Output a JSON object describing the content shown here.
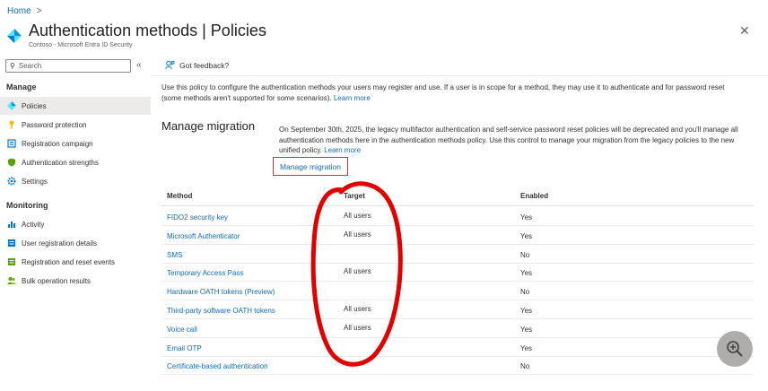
{
  "breadcrumb": {
    "home": "Home",
    "separator": ">"
  },
  "header": {
    "title": "Authentication methods | Policies",
    "subtitle": "Contoso - Microsoft Entra ID Security",
    "more": "···",
    "close": "✕"
  },
  "sidebar": {
    "search_placeholder": "Search",
    "collapse": "«",
    "sections": [
      {
        "label": "Manage"
      },
      {
        "label": "Monitoring"
      }
    ],
    "items": [
      {
        "label": "Policies",
        "icon": "diamond-icon"
      },
      {
        "label": "Password protection",
        "icon": "key-icon"
      },
      {
        "label": "Registration campaign",
        "icon": "campaign-icon"
      },
      {
        "label": "Authentication strengths",
        "icon": "shield-icon"
      },
      {
        "label": "Settings",
        "icon": "gear-icon"
      },
      {
        "label": "Activity",
        "icon": "activity-icon"
      },
      {
        "label": "User registration details",
        "icon": "user-details-icon"
      },
      {
        "label": "Registration and reset events",
        "icon": "events-icon"
      },
      {
        "label": "Bulk operation results",
        "icon": "bulk-users-icon"
      }
    ]
  },
  "toolbar": {
    "feedback": "Got feedback?"
  },
  "description": {
    "text": "Use this policy to configure the authentication methods your users may register and use. If a user is in scope for a method, they may use it to authenticate and for password reset (some methods aren't supported for some scenarios).",
    "link": "Learn more"
  },
  "migration": {
    "title": "Manage migration",
    "text": "On September 30th, 2025, the legacy multifactor authentication and self-service password reset policies will be deprecated and you'll manage all authentication methods here in the authentication methods policy. Use this control to manage your migration from the legacy policies to the new unified policy.",
    "link": "Learn more",
    "button": "Manage migration"
  },
  "table": {
    "columns": [
      "Method",
      "Target",
      "Enabled"
    ],
    "rows": [
      {
        "method": "FIDO2 security key",
        "target": "All users",
        "enabled": "Yes"
      },
      {
        "method": "Microsoft Authenticator",
        "target": "All users",
        "enabled": "Yes"
      },
      {
        "method": "SMS",
        "target": "",
        "enabled": "No"
      },
      {
        "method": "Temporary Access Pass",
        "target": "All users",
        "enabled": "Yes"
      },
      {
        "method": "Hardware OATH tokens (Preview)",
        "target": "",
        "enabled": "No"
      },
      {
        "method": "Third-party software OATH tokens",
        "target": "All users",
        "enabled": "Yes"
      },
      {
        "method": "Voice call",
        "target": "All users",
        "enabled": "Yes"
      },
      {
        "method": "Email OTP",
        "target": "",
        "enabled": "Yes"
      },
      {
        "method": "Certificate-based authentication",
        "target": "",
        "enabled": "No"
      }
    ]
  },
  "colors": {
    "accent": "#0f6cbd",
    "annotation": "#e00000",
    "highlight_border": "#d13438"
  },
  "zoom": {
    "icon": "zoom-in-icon"
  }
}
